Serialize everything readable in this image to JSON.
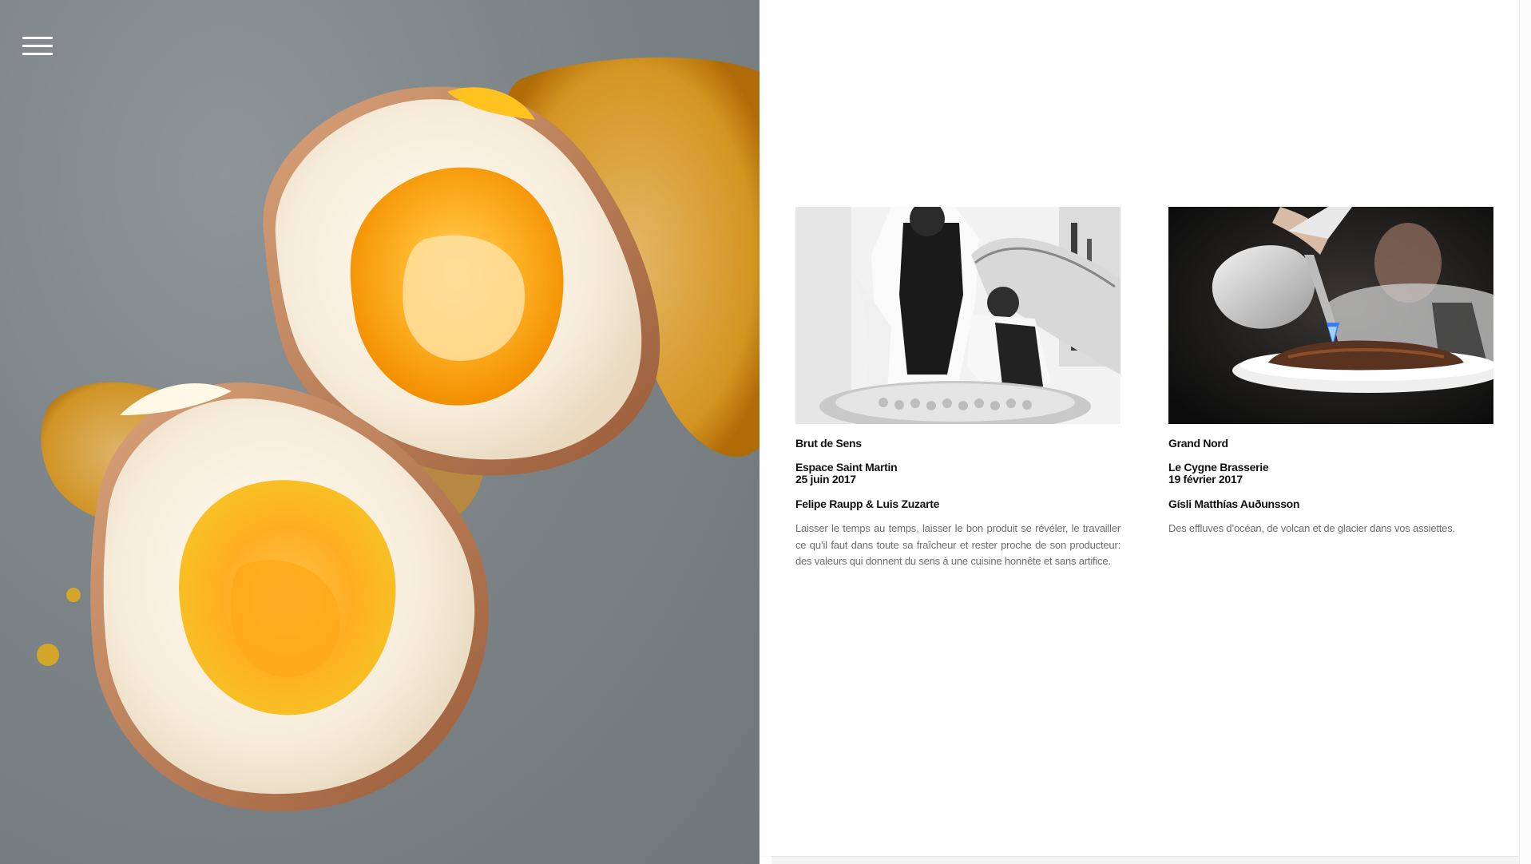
{
  "navigation": {
    "menu_icon": "hamburger-menu-icon"
  },
  "hero": {
    "image": "soft-boiled-eggs-photo"
  },
  "events": [
    {
      "title": "Brut de Sens",
      "venue": "Espace Saint Martin",
      "date": "25 juin 2017",
      "chefs": "Felipe Raupp & Luis Zuzarte",
      "description": "Laisser le temps au temps, laisser le bon produit se révéler, le travailler ce qu’il faut dans toute sa fraîcheur et rester proche de son producteur: des valeurs qui donnent du sens à une cuisine honnête et sans artifice.",
      "image": "chefs-kitchen-bw-photo"
    },
    {
      "title": "Grand Nord",
      "venue": "Le Cygne Brasserie",
      "date": "19 février 2017",
      "chefs": "Gísli Matthías Auðunsson",
      "description": "Des effluves d’océan, de volcan et de glacier dans vos assiettes.",
      "image": "chef-blowtorch-photo"
    }
  ],
  "colors": {
    "text_heading": "#111111",
    "text_body": "#6d6d6d",
    "background": "#ffffff"
  }
}
